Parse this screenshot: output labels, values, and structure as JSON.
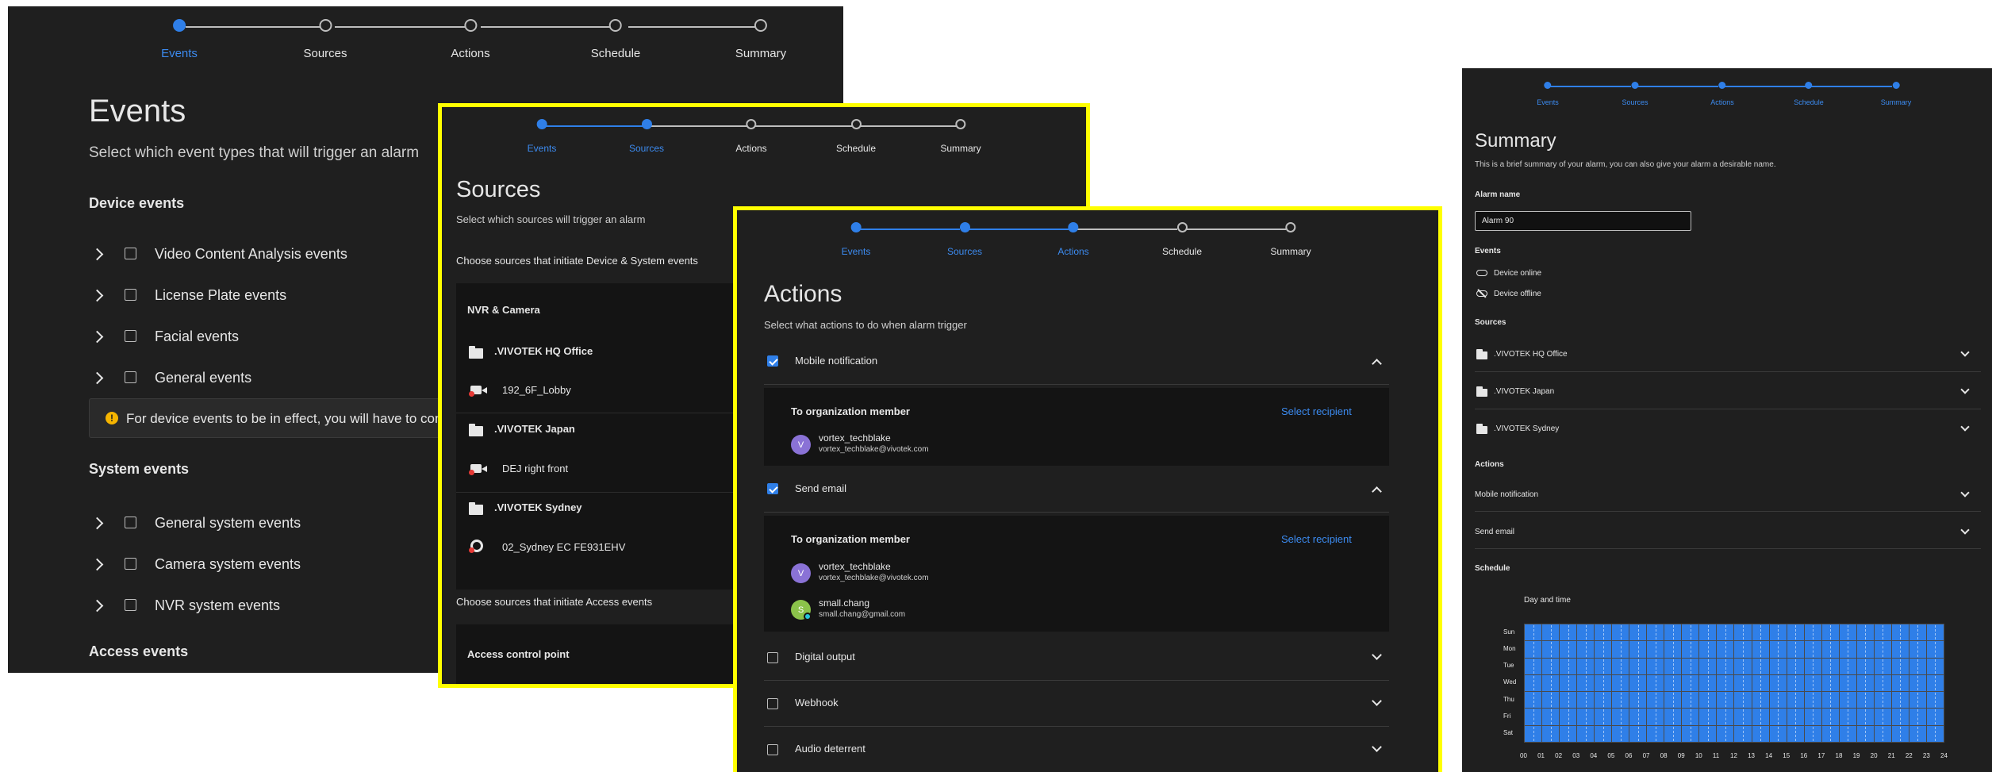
{
  "steps": [
    "Events",
    "Sources",
    "Actions",
    "Schedule",
    "Summary"
  ],
  "events_panel": {
    "title": "Events",
    "subtitle": "Select which event types that will trigger an alarm",
    "device_heading": "Device events",
    "device_items": [
      "Video Content Analysis events",
      "License Plate events",
      "Facial events",
      "General events"
    ],
    "info_text": "For device events to be in effect, you will have to configur",
    "system_heading": "System events",
    "system_items": [
      "General system events",
      "Camera system events",
      "NVR system events"
    ],
    "access_heading": "Access events"
  },
  "sources_panel": {
    "title": "Sources",
    "subtitle": "Select which sources will trigger an alarm",
    "device_label": "Choose sources that initiate Device & System events",
    "nvr_heading": "NVR & Camera",
    "groups": [
      {
        "name": ".VIVOTEK HQ Office",
        "device": "192_6F_Lobby"
      },
      {
        "name": ".VIVOTEK Japan",
        "device": "DEJ right front"
      },
      {
        "name": ".VIVOTEK Sydney",
        "device": "02_Sydney EC FE931EHV"
      }
    ],
    "access_label": "Choose sources that initiate Access events",
    "access_heading": "Access control point"
  },
  "actions_panel": {
    "title": "Actions",
    "subtitle": "Select what actions to do when alarm trigger",
    "mobile_label": "Mobile notification",
    "org_label": "To organization member",
    "select_recipient": "Select recipient",
    "member1_name": "vortex_techblake",
    "member1_email": "vortex_techblake@vivotek.com",
    "member1_initial": "V",
    "email_label": "Send email",
    "member2_name": "small.chang",
    "member2_email": "small.chang@gmail.com",
    "member2_initial": "S",
    "other_actions": [
      "Digital output",
      "Webhook",
      "Audio deterrent"
    ]
  },
  "summary_panel": {
    "title": "Summary",
    "subtitle": "This is a brief summary of your alarm, you can also give your alarm a desirable name.",
    "alarm_name_label": "Alarm name",
    "alarm_name_value": "Alarm 90",
    "events_heading": "Events",
    "event_items": [
      {
        "label": "Device online",
        "icon": "cloud-icon"
      },
      {
        "label": "Device offline",
        "icon": "cloud-off-icon"
      }
    ],
    "sources_heading": "Sources",
    "source_items": [
      ".VIVOTEK HQ Office",
      ".VIVOTEK Japan",
      ".VIVOTEK Sydney"
    ],
    "actions_heading": "Actions",
    "action_items": [
      "Mobile notification",
      "Send email"
    ],
    "schedule_heading": "Schedule",
    "schedule_title": "Day and time",
    "days": [
      "Sun",
      "Mon",
      "Tue",
      "Wed",
      "Thu",
      "Fri",
      "Sat"
    ],
    "hours": [
      "00",
      "01",
      "02",
      "03",
      "04",
      "05",
      "06",
      "07",
      "08",
      "09",
      "10",
      "11",
      "12",
      "13",
      "14",
      "15",
      "16",
      "17",
      "18",
      "19",
      "20",
      "21",
      "22",
      "23",
      "24"
    ],
    "schedule_coverage": "all days, all hours selected"
  },
  "colors": {
    "accent": "#2f7fe8",
    "highlight_border": "#ffff00",
    "panel_bg": "#1f1f1f",
    "info": "#f5b400"
  }
}
